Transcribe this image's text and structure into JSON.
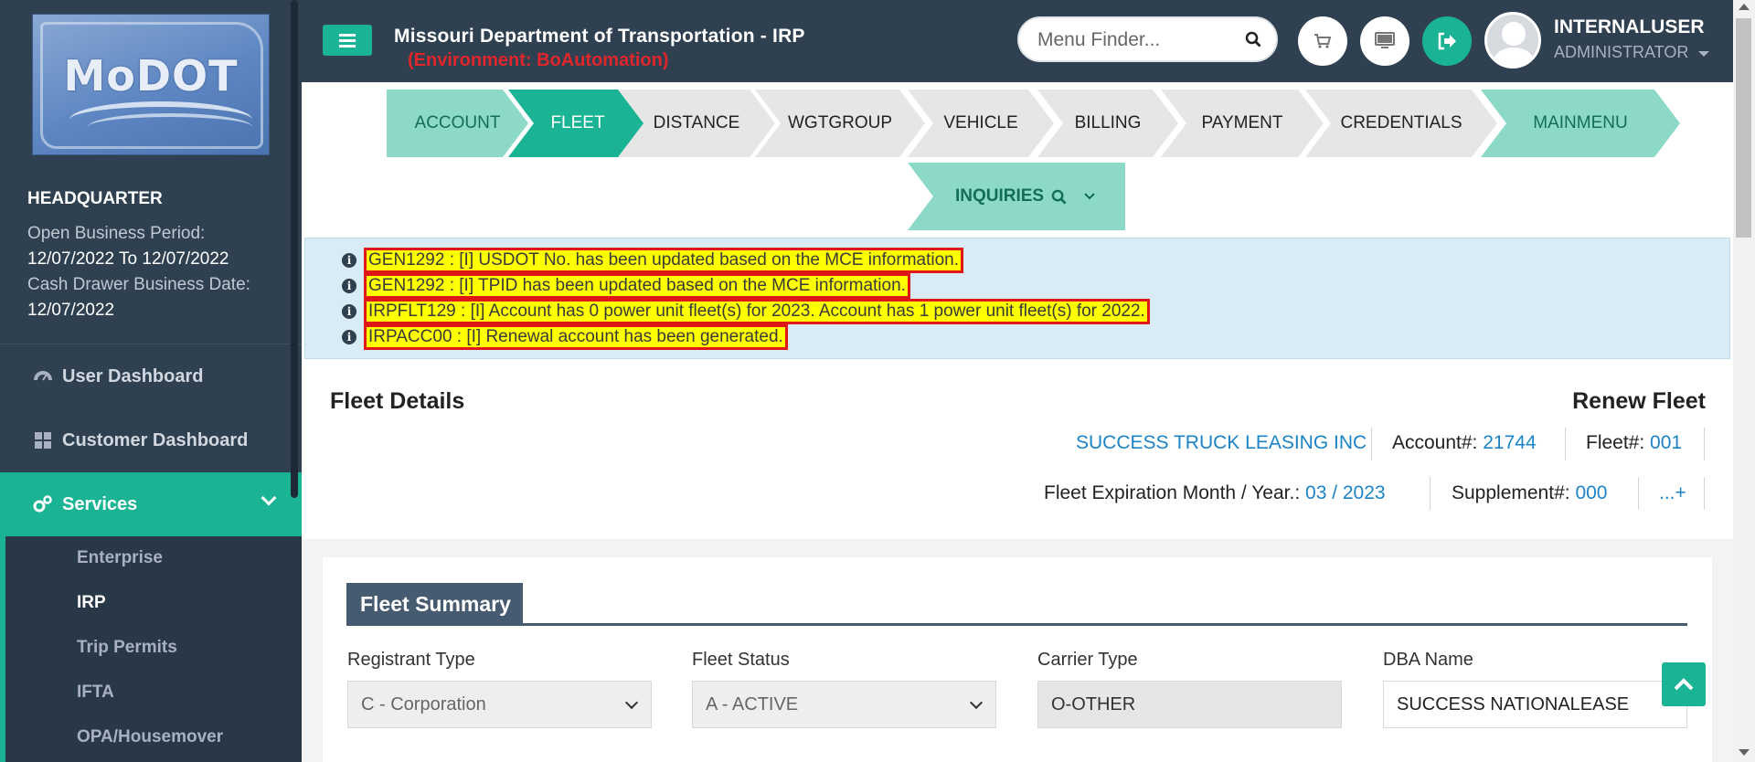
{
  "sidebar": {
    "logo_text": "MoDOT",
    "hq": "HEADQUARTER",
    "open_period_label": "Open Business Period:",
    "open_period_value": "12/07/2022 To 12/07/2022",
    "cash_label": "Cash Drawer Business Date:",
    "cash_value": "12/07/2022",
    "nav": [
      {
        "label": "User Dashboard",
        "icon": "dashboard-icon"
      },
      {
        "label": "Customer Dashboard",
        "icon": "grid-icon"
      },
      {
        "label": "Services",
        "icon": "cogs-icon"
      }
    ],
    "sub": [
      "Enterprise",
      "IRP",
      "Trip Permits",
      "IFTA",
      "OPA/Housemover"
    ]
  },
  "topbar": {
    "title": "Missouri Department of Transportation - IRP",
    "environment": "(Environment: BoAutomation)",
    "search_placeholder": "Menu Finder...",
    "user_name": "INTERNALUSER",
    "user_role": "ADMINISTRATOR"
  },
  "steps": [
    "ACCOUNT",
    "FLEET",
    "DISTANCE",
    "WGTGROUP",
    "VEHICLE",
    "BILLING",
    "PAYMENT",
    "CREDENTIALS",
    "MAINMENU"
  ],
  "inquiries": "INQUIRIES",
  "messages": [
    "GEN1292 : [I] USDOT No. has been updated based on the MCE information.",
    "GEN1292 : [I] TPID has been updated based on the MCE information.",
    "IRPFLT129 : [I] Account has 0 power unit fleet(s) for 2023. Account has 1 power unit fleet(s) for 2022.",
    "IRPACC00 : [I] Renewal account has been generated."
  ],
  "fleet_details": {
    "title": "Fleet Details",
    "action": "Renew Fleet",
    "company": "SUCCESS TRUCK LEASING INC",
    "account_label": "Account#:",
    "account_value": "21744",
    "fleet_label": "Fleet#:",
    "fleet_value": "001",
    "expiration_label": "Fleet Expiration Month / Year.:",
    "expiration_value": "03 / 2023",
    "supplement_label": "Supplement#:",
    "supplement_value": "000",
    "more": "...+"
  },
  "fleet_summary": {
    "tab": "Fleet Summary",
    "fields": [
      {
        "label": "Registrant Type",
        "value": "C - Corporation"
      },
      {
        "label": "Fleet Status",
        "value": "A - ACTIVE"
      },
      {
        "label": "Carrier Type",
        "value": "O-OTHER"
      },
      {
        "label": "DBA Name",
        "value": "SUCCESS NATIONALEASE"
      }
    ]
  },
  "colors": {
    "sidebar": "#2f4050",
    "accent": "#1ab394",
    "step_light": "#8cd9c7",
    "highlight": "#ffff00",
    "highlight_border": "#e01717",
    "link_blue": "#1c84c6"
  }
}
